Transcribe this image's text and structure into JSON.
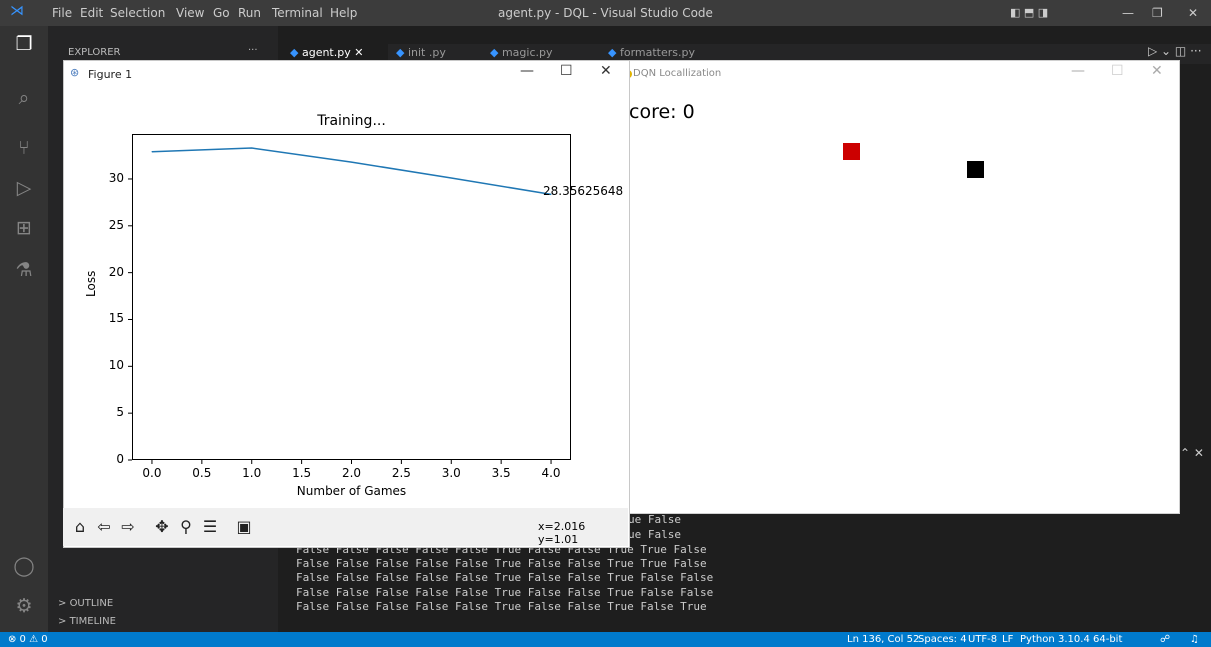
{
  "vscode": {
    "menu": [
      "File",
      "Edit",
      "Selection",
      "View",
      "Go",
      "Run",
      "Terminal",
      "Help"
    ],
    "window_title": "agent.py - DQL - Visual Studio Code",
    "sidebar": {
      "explorer_label": "EXPLORER",
      "outline_label": "OUTLINE",
      "timeline_label": "TIMELINE"
    },
    "tabs": [
      {
        "label": "agent.py",
        "active": true
      },
      {
        "label": "init .py",
        "active": false
      },
      {
        "label": "magic.py",
        "active": false
      },
      {
        "label": "formatters.py",
        "active": false
      }
    ],
    "terminal_lines": [
      "ue False",
      "ue False",
      "False False False False False True False False True True False",
      "False False False False False True False False True True False",
      "False False False False False True False False True False False",
      "False False False False False True False False True False False",
      "False False False False False True False False True False True"
    ],
    "status": {
      "left": "⊗ 0 ⚠ 0",
      "right": [
        "Ln 136, Col 52",
        "Spaces: 4",
        "UTF-8",
        "LF",
        "Python",
        "3.10.4 64-bit"
      ]
    },
    "colors": {
      "statusbar": "#007acc",
      "activitybar": "#333333",
      "editor": "#1e1e1e"
    },
    "activity_icons": [
      "files-icon",
      "search-icon",
      "source-control-icon",
      "run-debug-icon",
      "extensions-icon",
      "testing-icon"
    ]
  },
  "figure_window": {
    "title": "Figure 1",
    "coords_readout": "x=2.016 y=1.01",
    "toolbar_icons": [
      "home-icon",
      "back-icon",
      "forward-icon",
      "pan-icon",
      "zoom-icon",
      "configure-icon",
      "save-icon"
    ]
  },
  "dqn_window": {
    "title": "DQN Locallization",
    "score_text": "core: 0",
    "colors": {
      "red_block": "#cc0000",
      "black_block": "#000000"
    }
  },
  "chart_data": {
    "type": "line",
    "title": "Training...",
    "xlabel": "Number of Games",
    "ylabel": "Loss",
    "x": [
      0,
      1,
      2,
      3,
      4
    ],
    "series": [
      {
        "values": [
          32.9,
          33.3,
          31.8,
          30.1,
          28.35625648
        ]
      }
    ],
    "end_label": "28.35625648",
    "xlim": [
      -0.2,
      4.2
    ],
    "ylim": [
      0,
      34.8
    ],
    "xticks": [
      "0.0",
      "0.5",
      "1.0",
      "1.5",
      "2.0",
      "2.5",
      "3.0",
      "3.5",
      "4.0"
    ],
    "xtick_values": [
      0,
      0.5,
      1,
      1.5,
      2,
      2.5,
      3,
      3.5,
      4
    ],
    "yticks": [
      "0",
      "5",
      "10",
      "15",
      "20",
      "25",
      "30"
    ],
    "ytick_values": [
      0,
      5,
      10,
      15,
      20,
      25,
      30
    ],
    "line_color": "#1f77b4",
    "grid": false
  }
}
